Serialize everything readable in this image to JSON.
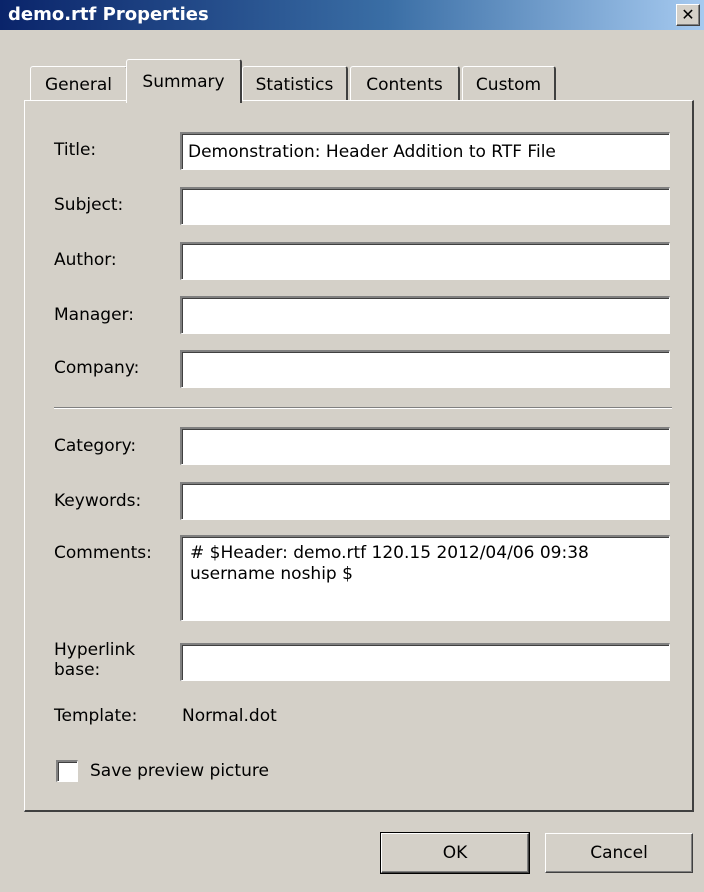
{
  "window": {
    "title": "demo.rtf Properties",
    "close_label": "✕"
  },
  "tabs": [
    {
      "label": "General",
      "active": false
    },
    {
      "label": "Summary",
      "active": true
    },
    {
      "label": "Statistics",
      "active": false
    },
    {
      "label": "Contents",
      "active": false
    },
    {
      "label": "Custom",
      "active": false
    }
  ],
  "fields": {
    "title": {
      "label": "Title:",
      "value": "Demonstration: Header Addition to RTF File"
    },
    "subject": {
      "label": "Subject:",
      "value": ""
    },
    "author": {
      "label": "Author:",
      "value": ""
    },
    "manager": {
      "label": "Manager:",
      "value": ""
    },
    "company": {
      "label": "Company:",
      "value": ""
    },
    "category": {
      "label": "Category:",
      "value": ""
    },
    "keywords": {
      "label": "Keywords:",
      "value": ""
    },
    "comments": {
      "label": "Comments:",
      "value": "# $Header: demo.rtf 120.15 2012/04/06 09:38 username noship $"
    },
    "hyperlink_base": {
      "label": "Hyperlink base:",
      "value": ""
    }
  },
  "template": {
    "label": "Template:",
    "value": "Normal.dot"
  },
  "save_preview": {
    "label": "Save preview picture",
    "checked": false
  },
  "buttons": {
    "ok": "OK",
    "cancel": "Cancel"
  }
}
